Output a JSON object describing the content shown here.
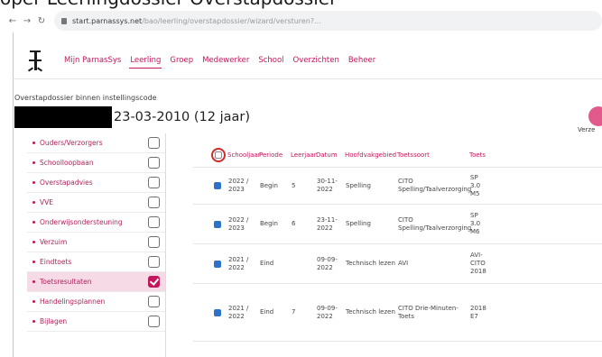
{
  "caption": "oper Leerlingdossier Overstapdossier",
  "browser": {
    "url_host": "start.parnassys.net",
    "url_path": "/bao/leerling/overstapdossier/wizard/versturen?..."
  },
  "nav": {
    "items": [
      {
        "label": "Mijn ParnasSys",
        "active": false
      },
      {
        "label": "Leerling",
        "active": true
      },
      {
        "label": "Groep",
        "active": false
      },
      {
        "label": "Medewerker",
        "active": false
      },
      {
        "label": "School",
        "active": false
      },
      {
        "label": "Overzichten",
        "active": false
      },
      {
        "label": "Beheer",
        "active": false
      }
    ]
  },
  "breadcrumb": "Overstapdossier binnen instellingscode",
  "student": {
    "birth": "23-03-2010 (12 jaar)"
  },
  "send_label": "Verze",
  "sidebar": {
    "items": [
      {
        "label": "Ouders/Verzorgers",
        "checked": false,
        "active": false
      },
      {
        "label": "Schoolloopbaan",
        "checked": false,
        "active": false
      },
      {
        "label": "Overstapadvies",
        "checked": false,
        "active": false
      },
      {
        "label": "VVE",
        "checked": false,
        "active": false
      },
      {
        "label": "Onderwijsondersteuning",
        "checked": false,
        "active": false
      },
      {
        "label": "Verzuim",
        "checked": false,
        "active": false
      },
      {
        "label": "Eindtoets",
        "checked": false,
        "active": false
      },
      {
        "label": "Toetsresultaten",
        "checked": true,
        "active": true
      },
      {
        "label": "Handelingsplannen",
        "checked": false,
        "active": false
      },
      {
        "label": "Bijlagen",
        "checked": false,
        "active": false
      }
    ]
  },
  "table": {
    "headers": [
      "Schooljaar",
      "Periode",
      "Leerjaar",
      "Datum",
      "Hoofdvakgebied",
      "Toetssoort",
      "Toets"
    ],
    "rows": [
      {
        "schooljaar": [
          "2022 /",
          "2023"
        ],
        "periode": "Begin",
        "leerjaar": "5",
        "datum": [
          "30-11-",
          "2022"
        ],
        "domein": "Spelling",
        "soort": [
          "CITO",
          "Spelling/Taalverzorging"
        ],
        "toets": [
          "SP",
          "3.0",
          "M5"
        ]
      },
      {
        "schooljaar": [
          "2022 /",
          "2023"
        ],
        "periode": "Begin",
        "leerjaar": "6",
        "datum": [
          "23-11-",
          "2022"
        ],
        "domein": "Spelling",
        "soort": [
          "CITO",
          "Spelling/Taalverzorging"
        ],
        "toets": [
          "SP",
          "3.0",
          "M6"
        ]
      },
      {
        "schooljaar": [
          "2021 /",
          "2022"
        ],
        "periode": "Eind",
        "leerjaar": "",
        "datum": [
          "09-09-",
          "2022"
        ],
        "domein": "Technisch lezen",
        "soort": [
          "AVI"
        ],
        "toets": [
          "AVI-",
          "CITO",
          "2018"
        ]
      },
      {
        "schooljaar": [
          "2021 /",
          "2022"
        ],
        "periode": "Eind",
        "leerjaar": "7",
        "datum": [
          "09-09-",
          "2022"
        ],
        "domein": "Technisch lezen",
        "soort": [
          "CITO Drie-Minuten-",
          "Toets"
        ],
        "toets": [
          "2018",
          "E7"
        ]
      }
    ]
  }
}
